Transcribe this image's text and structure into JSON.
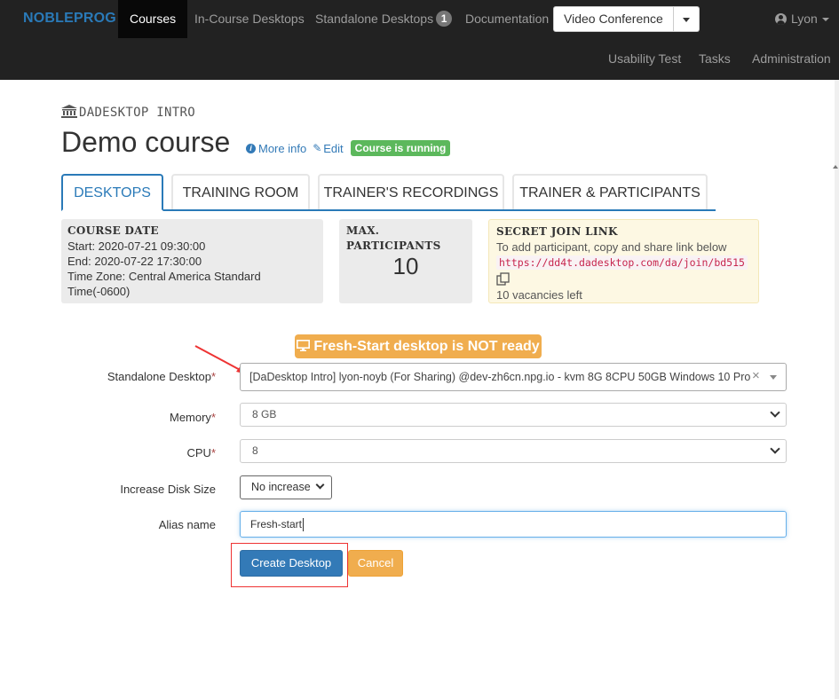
{
  "navbar": {
    "brand": "NOBLEPROG",
    "items": [
      "Courses",
      "In-Course Desktops",
      "Standalone Desktops",
      "Documentation"
    ],
    "standalone_badge": "1",
    "video_conference": "Video Conference",
    "user": "Lyon",
    "secondary": [
      "Usability Test",
      "Tasks",
      "Administration"
    ]
  },
  "header": {
    "breadcrumb": "DADESKTOP INTRO",
    "title": "Demo course",
    "more_info": "More info",
    "edit": "Edit",
    "status": "Course is running"
  },
  "tabs": [
    "DESKTOPS",
    "TRAINING ROOM",
    "TRAINER'S RECORDINGS",
    "TRAINER & PARTICIPANTS"
  ],
  "course_date": {
    "heading": "COURSE DATE",
    "start": "Start: 2020-07-21 09:30:00",
    "end": "End: 2020-07-22 17:30:00",
    "timezone": "Time Zone: Central America Standard Time(-0600)"
  },
  "max_participants": {
    "heading_1": "MAX.",
    "heading_2": "PARTICIPANTS",
    "value": "10"
  },
  "secret_link": {
    "heading": "SECRET JOIN LINK",
    "description": "To add participant, copy and share link below",
    "url": "https://dd4t.dadesktop.com/da/join/bd515",
    "vacancies": "10 vacancies left"
  },
  "warning": "Fresh-Start desktop is NOT ready",
  "form": {
    "standalone_label": "Standalone Desktop",
    "standalone_value": "[DaDesktop Intro] lyon-noyb (For Sharing) @dev-zh6cn.npg.io - kvm 8G 8CPU 50GB Windows 10 Pro",
    "memory_label": "Memory",
    "memory_value": "8 GB",
    "cpu_label": "CPU",
    "cpu_value": "8",
    "disk_label": "Increase Disk Size",
    "disk_value": "No increase",
    "alias_label": "Alias name",
    "alias_value": "Fresh-start",
    "required_mark": "*",
    "create_button": "Create Desktop",
    "cancel_button": "Cancel"
  },
  "colors": {
    "navbar_bg": "#222222",
    "brand": "#2a7ab8",
    "primary": "#337ab7",
    "warning": "#f0ad4e",
    "success": "#5cb85c",
    "annotation": "#e33333"
  },
  "icons": [
    "bank-icon",
    "info-icon",
    "pencil-icon",
    "user-icon",
    "copy-icon",
    "monitor-icon",
    "chevron-down-icon",
    "clear-icon"
  ]
}
